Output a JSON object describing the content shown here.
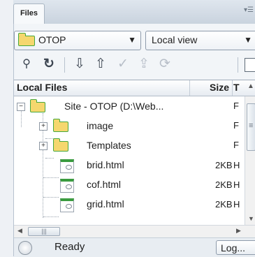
{
  "panel": {
    "tab_label": "Files",
    "tab_menu_icon": "panel-menu-icon"
  },
  "site_select": {
    "value": "OTOP"
  },
  "view_select": {
    "value": "Local view"
  },
  "toolbar": {
    "buttons": [
      {
        "icon": "connect-icon"
      },
      {
        "icon": "refresh-icon"
      },
      {
        "icon": "get-icon"
      },
      {
        "icon": "put-icon"
      },
      {
        "icon": "check-out-icon"
      },
      {
        "icon": "check-in-icon"
      },
      {
        "icon": "synchronize-icon"
      },
      {
        "icon": "expand-icon"
      }
    ]
  },
  "columns": {
    "name": "Local Files",
    "size": "Size",
    "type": "T"
  },
  "tree": [
    {
      "name": "Site - OTOP (D:\\Web...",
      "size": "",
      "type": "F",
      "kind": "site"
    },
    {
      "name": "image",
      "size": "",
      "type": "F",
      "kind": "folder"
    },
    {
      "name": "Templates",
      "size": "",
      "type": "F",
      "kind": "folder"
    },
    {
      "name": "brid.html",
      "size": "2KB",
      "type": "H",
      "kind": "file"
    },
    {
      "name": "cof.html",
      "size": "2KB",
      "type": "H",
      "kind": "file"
    },
    {
      "name": "grid.html",
      "size": "2KB",
      "type": "H",
      "kind": "file"
    }
  ],
  "status": {
    "text": "Ready",
    "log_button": "Log..."
  }
}
